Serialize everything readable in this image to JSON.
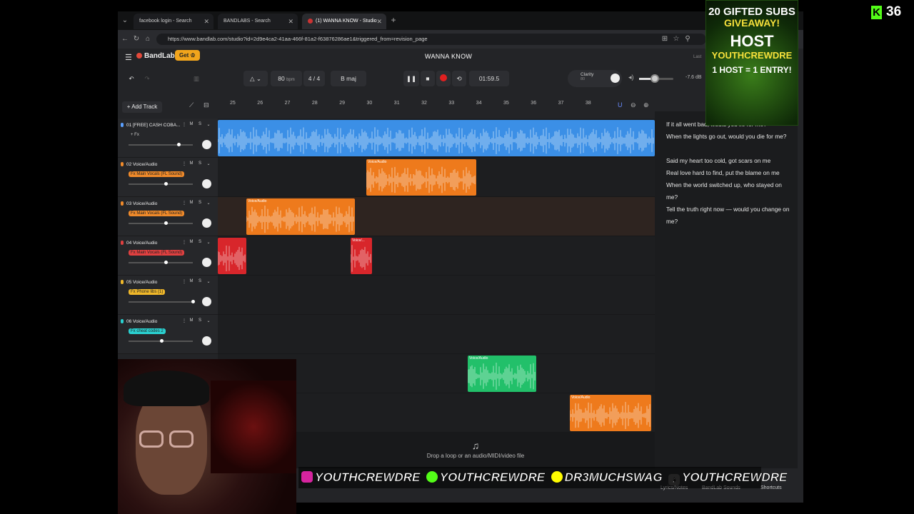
{
  "browser": {
    "tabs": [
      {
        "label": "facebook login - Search"
      },
      {
        "label": "BANDLABS - Search"
      },
      {
        "label": "(1) WANNA KNOW - Studio"
      }
    ],
    "url": "https://www.bandlab.com/studio?id=2d9e4ca2-41aa-466f-81a2-f63876286ae1&triggered_from=revision_page"
  },
  "app": {
    "logo": "BandLab",
    "get_button": "Get ♔",
    "project_title": "WANNA KNOW",
    "last_saved": "Last"
  },
  "transport": {
    "bpm": "80",
    "bpm_unit": "bpm",
    "time_signature": "4 / 4",
    "key": "B maj",
    "time": "01:59.5",
    "clarity_label": "Clarity",
    "clarity_value": "80",
    "volume_db": "-7.6 dB",
    "volume_level": 0.45
  },
  "add_track_label": "+ Add Track",
  "ruler": [
    "25",
    "26",
    "27",
    "28",
    "29",
    "30",
    "31",
    "32",
    "33",
    "34",
    "35",
    "36",
    "37",
    "38"
  ],
  "tracks": [
    {
      "name": "01  [FREE] CASH COBA...",
      "fx": "+ Fx",
      "mute": "M",
      "solo": "S"
    },
    {
      "name": "02  Voice/Audio",
      "fx": "Fx Main Vocals (FL Sound)",
      "mute": "M",
      "solo": "S"
    },
    {
      "name": "03  Voice/Audio",
      "fx": "Fx Main Vocals (FL Sound)",
      "mute": "M",
      "solo": "S"
    },
    {
      "name": "04  Voice/Audio",
      "fx": "Fx Main Vocals (FL Sound)",
      "mute": "M",
      "solo": "S"
    },
    {
      "name": "05  Voice/Audio",
      "fx": "Fx Phone libs (1)",
      "mute": "M",
      "solo": "S"
    },
    {
      "name": "06  Voice/Audio",
      "fx": "Fx cheat codes 2",
      "mute": "M",
      "solo": "S"
    }
  ],
  "clip_label": "Voice/Audio",
  "clip_label_short": "Voice/...",
  "dropzone": {
    "text": "Drop a loop or an audio/MIDI/video file"
  },
  "lyrics": [
    "If it all went bad, would you lie for me?",
    "When the lights go out, would you die for me?",
    "",
    "Said my heart too cold, got scars on me",
    "Real love hard to find, put the blame on me",
    "When the world switched up, who stayed on me?",
    "Tell the truth right now — would you change on me?"
  ],
  "bottombar": {
    "lyrics": "Lyrics/Notes",
    "sounds": "BandLab Sounds",
    "shortcuts": "Shortcuts"
  },
  "overlay": {
    "kick_count": "36",
    "promo": [
      "20 GIFTED SUBS",
      "GIVEAWAY!",
      "HOST",
      "YOUTHCREWDRE",
      "1 HOST = 1 ENTRY!"
    ],
    "socials": [
      "YOUTHCREWDRE",
      "YOUTHCREWDRE",
      "DR3MUCHSWAG",
      "YOUTHCREWDRE"
    ]
  },
  "colors": {
    "blue": "#3b8fe6",
    "orange": "#ee7a1c",
    "red": "#d8262b",
    "green": "#22c06a",
    "kick": "#53fc18"
  }
}
